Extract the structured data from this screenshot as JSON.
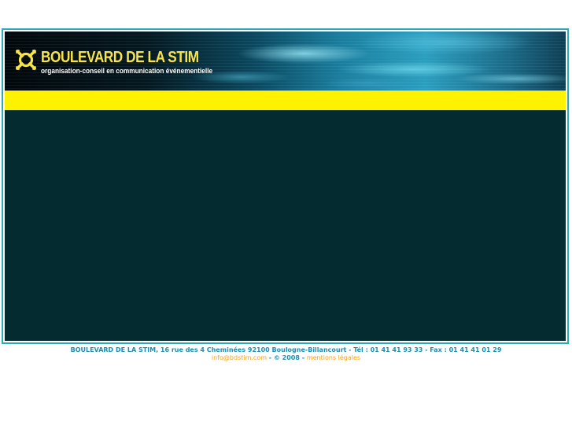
{
  "header": {
    "brand_name": "BOULEVARD DE LA STIM",
    "tagline": "organisation-conseil en communication événementielle",
    "logo_icon": "x-cross-logo-icon",
    "colors": {
      "brand_yellow": "#f7e34a",
      "bar_yellow": "#fff200",
      "panel_dark": "#032b30",
      "frame_teal": "#2fa9b6"
    }
  },
  "footer": {
    "address_line": "BOULEVARD DE LA STIM, 16 rue des 4 Cheminées 92100 Boulogne-Billancourt - Tél : 01 41 41 93 33 - Fax : 01 41 41 01 29",
    "email": "info@bdstim.com",
    "sep1": " - ",
    "copyright": "© 2008",
    "sep2": " - ",
    "legal": "mentions légales",
    "colors": {
      "text_blue": "#1a8fb3",
      "link_orange": "#f4a118"
    }
  }
}
